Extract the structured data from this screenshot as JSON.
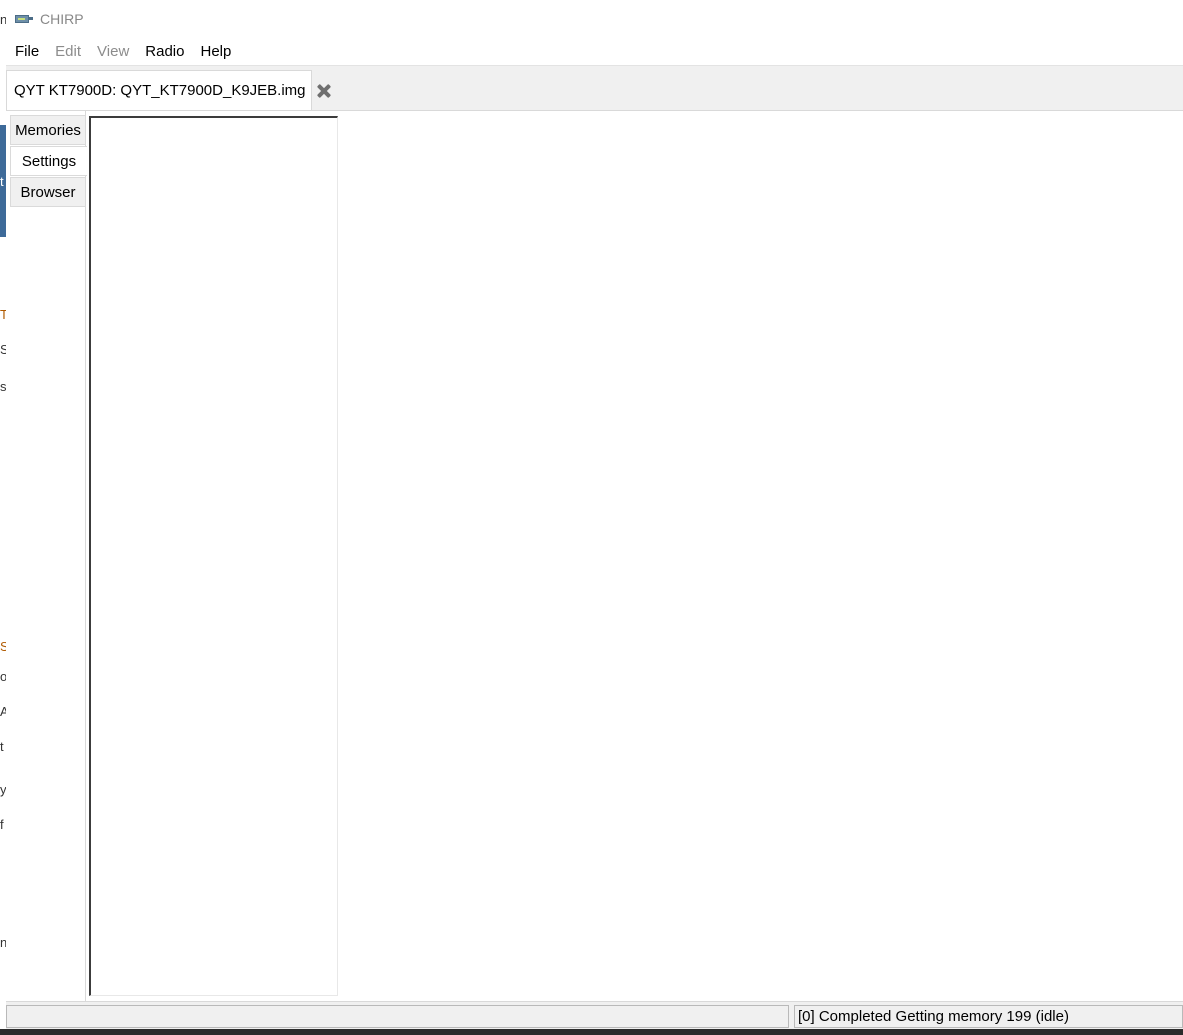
{
  "window": {
    "title": "CHIRP"
  },
  "menu": {
    "items": [
      {
        "label": "File",
        "enabled": true
      },
      {
        "label": "Edit",
        "enabled": false
      },
      {
        "label": "View",
        "enabled": false
      },
      {
        "label": "Radio",
        "enabled": true
      },
      {
        "label": "Help",
        "enabled": true
      }
    ]
  },
  "document_tab": {
    "label": "QYT KT7900D: QYT_KT7900D_K9JEB.img",
    "close_icon": "close-icon"
  },
  "side_tabs": {
    "items": [
      {
        "label": "Memories"
      },
      {
        "label": "Settings",
        "active": true
      },
      {
        "label": "Browser"
      }
    ]
  },
  "statusbar": {
    "left_text": "",
    "right_text": "[0] Completed Getting memory 199 (idle)"
  },
  "background_fragments": [
    "n",
    "t",
    "T",
    "S",
    "s",
    "S",
    "o",
    "A",
    "t",
    "y",
    "f",
    "n"
  ]
}
